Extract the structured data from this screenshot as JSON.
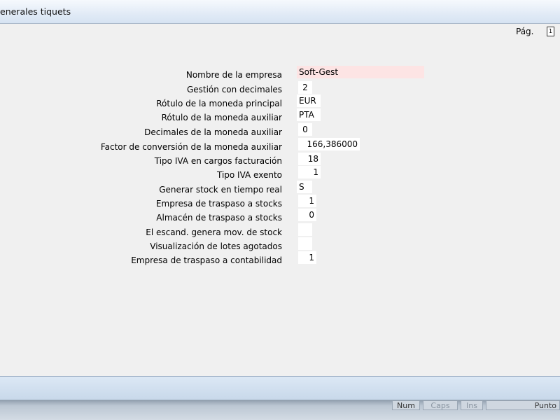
{
  "window": {
    "title": "enerales tiquets"
  },
  "toolbar": {
    "page_label": "Pág.",
    "page_number": "1"
  },
  "form": {
    "rows": [
      {
        "label": "Nombre de la empresa",
        "value": "Soft-Gest"
      },
      {
        "label": "Gestión con decimales",
        "value": "2"
      },
      {
        "label": "Rótulo de la moneda principal",
        "value": "EUR"
      },
      {
        "label": "Rótulo de la moneda auxiliar",
        "value": "PTA"
      },
      {
        "label": "Decimales de la moneda auxiliar",
        "value": "0"
      },
      {
        "label": "Factor de conversión de la moneda auxiliar",
        "value": "166,386000"
      },
      {
        "label": "Tipo IVA en cargos facturación",
        "value": "18"
      },
      {
        "label": "Tipo IVA exento",
        "value": "1"
      },
      {
        "label": "Generar stock en tiempo real",
        "value": "S"
      },
      {
        "label": "Empresa de traspaso a stocks",
        "value": "1"
      },
      {
        "label": "Almacén de traspaso a stocks",
        "value": "0"
      },
      {
        "label": "El escand. genera mov. de stock",
        "value": ""
      },
      {
        "label": "Visualización de lotes agotados",
        "value": ""
      },
      {
        "label": "Empresa de traspaso a contabilidad",
        "value": "1"
      }
    ]
  },
  "statusbar": {
    "num": "Num",
    "caps": "Caps",
    "ins": "Ins",
    "punto": "Punto"
  }
}
